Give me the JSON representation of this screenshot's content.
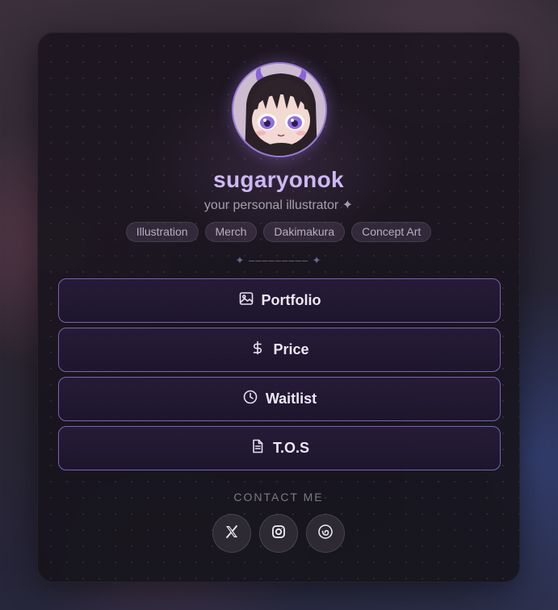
{
  "profile": {
    "name": "sugaryonok",
    "tagline": "your personal illustrator ✦"
  },
  "tags": [
    "Illustration",
    "Merch",
    "Dakimakura",
    "Concept Art"
  ],
  "divider": "✦ ––––––––– ✦",
  "links": [
    {
      "label": "Portfolio",
      "icon": "image-icon"
    },
    {
      "label": "Price",
      "icon": "dollar-icon"
    },
    {
      "label": "Waitlist",
      "icon": "clock-icon"
    },
    {
      "label": "T.O.S",
      "icon": "document-icon"
    }
  ],
  "contact": {
    "label": "CONTACT ME",
    "socials": [
      "x-icon",
      "instagram-icon",
      "vgen-icon"
    ]
  },
  "colors": {
    "accent": "#9a7ad6",
    "title": "#cdb8f3",
    "button_border": "#7a63b0"
  }
}
